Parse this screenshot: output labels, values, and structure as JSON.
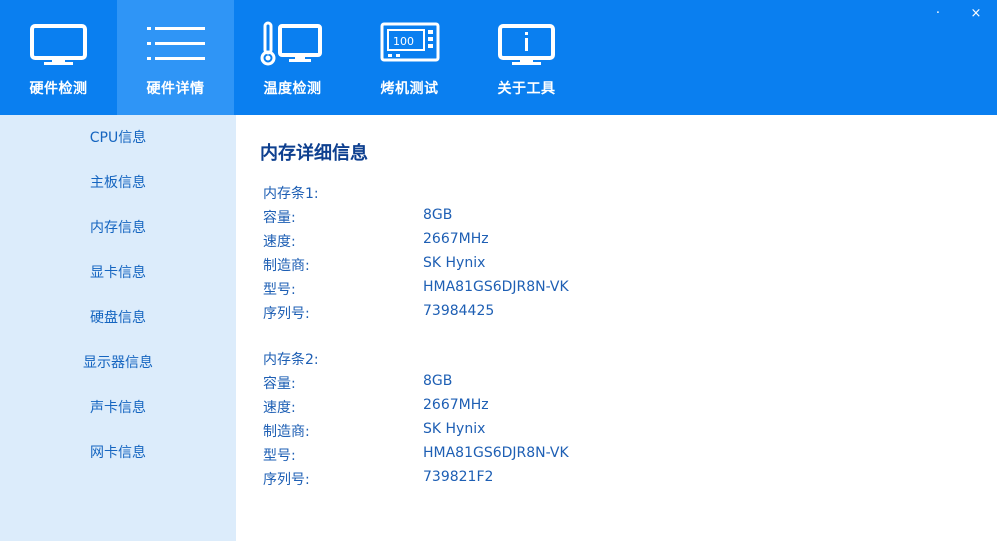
{
  "toolbar": {
    "tabs": [
      {
        "label": "硬件检测",
        "icon": "monitor-icon"
      },
      {
        "label": "硬件详情",
        "icon": "list-icon"
      },
      {
        "label": "温度检测",
        "icon": "thermometer-monitor-icon"
      },
      {
        "label": "烤机测试",
        "icon": "benchmark-icon"
      },
      {
        "label": "关于工具",
        "icon": "info-monitor-icon"
      }
    ],
    "active_tab": "硬件详情",
    "minimize": "·",
    "close": "×"
  },
  "sidebar": {
    "items": [
      {
        "label": "CPU信息"
      },
      {
        "label": "主板信息"
      },
      {
        "label": "内存信息"
      },
      {
        "label": "显卡信息"
      },
      {
        "label": "硬盘信息"
      },
      {
        "label": "显示器信息"
      },
      {
        "label": "声卡信息"
      },
      {
        "label": "网卡信息"
      }
    ]
  },
  "main": {
    "title": "内存详细信息",
    "modules": [
      {
        "title": "内存条1:",
        "fields": [
          {
            "key": "容量:",
            "value": "8GB"
          },
          {
            "key": "速度:",
            "value": "2667MHz"
          },
          {
            "key": "制造商:",
            "value": "SK Hynix"
          },
          {
            "key": "型号:",
            "value": "HMA81GS6DJR8N-VK"
          },
          {
            "key": "序列号:",
            "value": "73984425"
          }
        ]
      },
      {
        "title": "内存条2:",
        "fields": [
          {
            "key": "容量:",
            "value": "8GB"
          },
          {
            "key": "速度:",
            "value": "2667MHz"
          },
          {
            "key": "制造商:",
            "value": "SK Hynix"
          },
          {
            "key": "型号:",
            "value": "HMA81GS6DJR8N-VK"
          },
          {
            "key": "序列号:",
            "value": "739821F2"
          }
        ]
      }
    ]
  },
  "colors": {
    "toolbar_bg": "#0a7ff0",
    "active_tab_bg": "#2f95f6",
    "sidebar_bg": "#dcecfb",
    "text_blue": "#1e5fb4",
    "heading": "#0d3f8f"
  }
}
